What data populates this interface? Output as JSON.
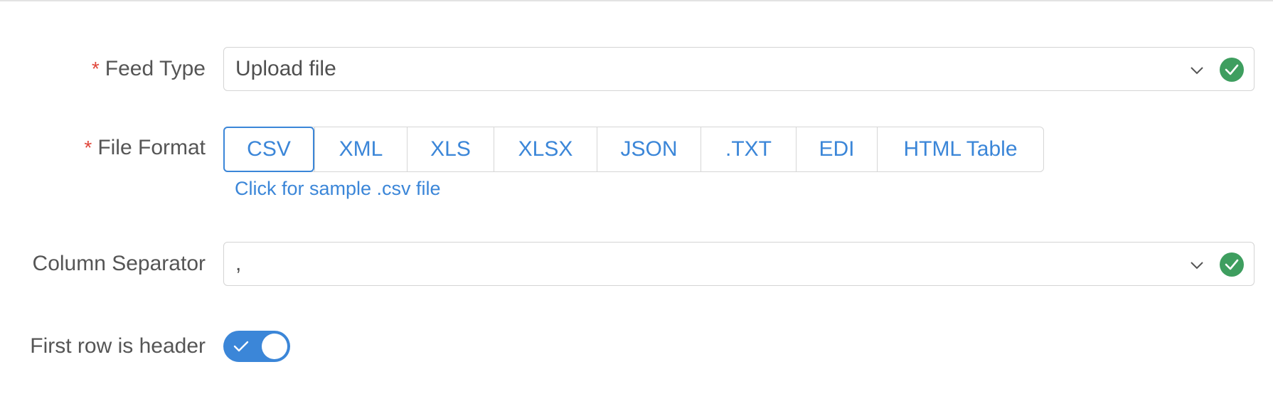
{
  "feed_type": {
    "label": "Feed Type",
    "required_mark": "*",
    "value": "Upload file",
    "status_icon": "check-circle-icon"
  },
  "file_format": {
    "label": "File Format",
    "required_mark": "*",
    "options": [
      "CSV",
      "XML",
      "XLS",
      "XLSX",
      "JSON",
      ".TXT",
      "EDI",
      "HTML Table"
    ],
    "selected": "CSV",
    "sample_link": "Click for sample .csv file"
  },
  "column_separator": {
    "label": "Column Separator",
    "value": ",",
    "status_icon": "check-circle-icon"
  },
  "first_row_header": {
    "label": "First row is header",
    "enabled": true
  },
  "colors": {
    "accent": "#3b86d8",
    "success": "#3e9e5f",
    "required": "#e0463a"
  }
}
